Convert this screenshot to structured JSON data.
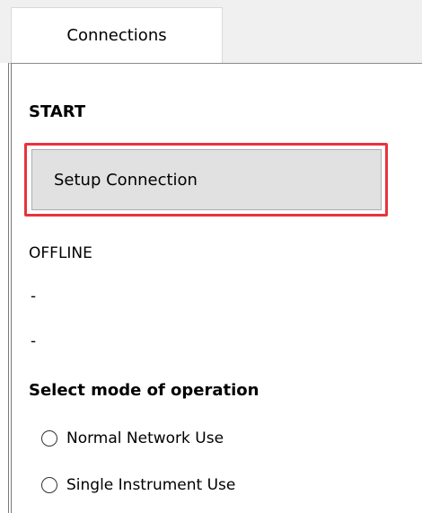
{
  "tabs": [
    {
      "label": "Connections",
      "selected": true
    }
  ],
  "panel": {
    "start_title": "START",
    "setup_button_label": "Setup Connection",
    "status_text": "OFFLINE",
    "info_line_1": "-",
    "info_line_2": "-",
    "mode_title": "Select mode of operation",
    "modes": [
      {
        "label": "Normal Network Use",
        "selected": false
      },
      {
        "label": "Single Instrument Use",
        "selected": false
      }
    ]
  },
  "colors": {
    "highlight": "#e8333c",
    "button_bg": "#e1e1e1",
    "tab_strip_bg": "#f0f0f0"
  }
}
